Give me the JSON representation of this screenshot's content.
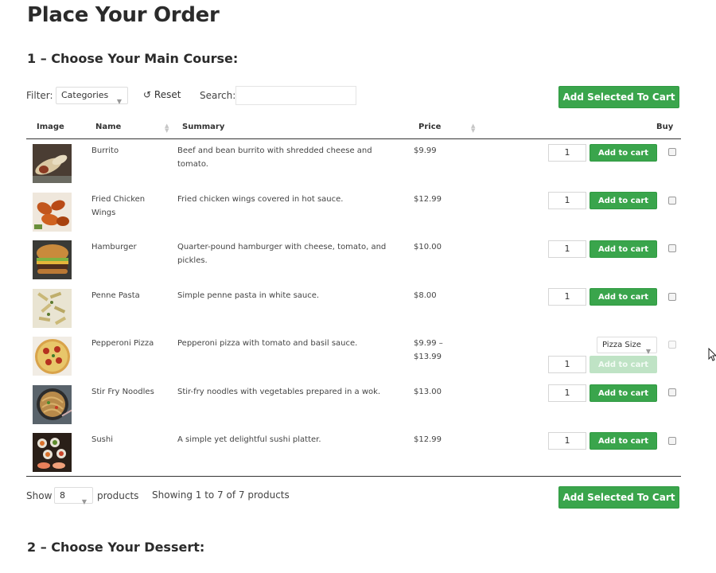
{
  "page": {
    "title": "Place Your Order"
  },
  "section1": {
    "title": "1 – Choose Your Main Course:"
  },
  "section2": {
    "title": "2 – Choose Your Dessert:"
  },
  "toolbar": {
    "filter_label": "Filter:",
    "filter_value": "Categories",
    "reset_label": "Reset",
    "search_label": "Search:",
    "search_value": "",
    "add_selected_label": "Add Selected To Cart"
  },
  "table": {
    "headers": {
      "image": "Image",
      "name": "Name",
      "summary": "Summary",
      "price": "Price",
      "buy": "Buy"
    },
    "add_to_cart_label": "Add to cart",
    "rows": [
      {
        "name": "Burrito",
        "summary": "Beef and bean burrito with shredded cheese and tomato.",
        "price": "$9.99",
        "qty": "1",
        "image_icon": "burrito-photo"
      },
      {
        "name": "Fried Chicken Wings",
        "summary": "Fried chicken wings covered in hot sauce.",
        "price": "$12.99",
        "qty": "1",
        "image_icon": "chicken-wings-photo"
      },
      {
        "name": "Hamburger",
        "summary": "Quarter-pound hamburger with cheese, tomato, and pickles.",
        "price": "$10.00",
        "qty": "1",
        "image_icon": "hamburger-photo"
      },
      {
        "name": "Penne Pasta",
        "summary": "Simple penne pasta in white sauce.",
        "price": "$8.00",
        "qty": "1",
        "image_icon": "penne-pasta-photo"
      },
      {
        "name": "Pepperoni Pizza",
        "summary": "Pepperoni pizza with tomato and basil sauce.",
        "price": "$9.99 – $13.99",
        "qty": "1",
        "variation_label": "Pizza Size",
        "image_icon": "pizza-photo"
      },
      {
        "name": "Stir Fry Noodles",
        "summary": "Stir-fry noodles with vegetables prepared in a wok.",
        "price": "$13.00",
        "qty": "1",
        "image_icon": "noodles-photo"
      },
      {
        "name": "Sushi",
        "summary": "A simple yet delightful sushi platter.",
        "price": "$12.99",
        "qty": "1",
        "image_icon": "sushi-photo"
      }
    ]
  },
  "footer": {
    "show_label": "Show",
    "show_value": "8",
    "products_label": "products",
    "showing_text": "Showing 1 to 7 of 7 products",
    "add_selected_label": "Add Selected To Cart"
  },
  "colors": {
    "accent": "#3aa54c",
    "text": "#2b2b2b",
    "border": "#333333"
  }
}
